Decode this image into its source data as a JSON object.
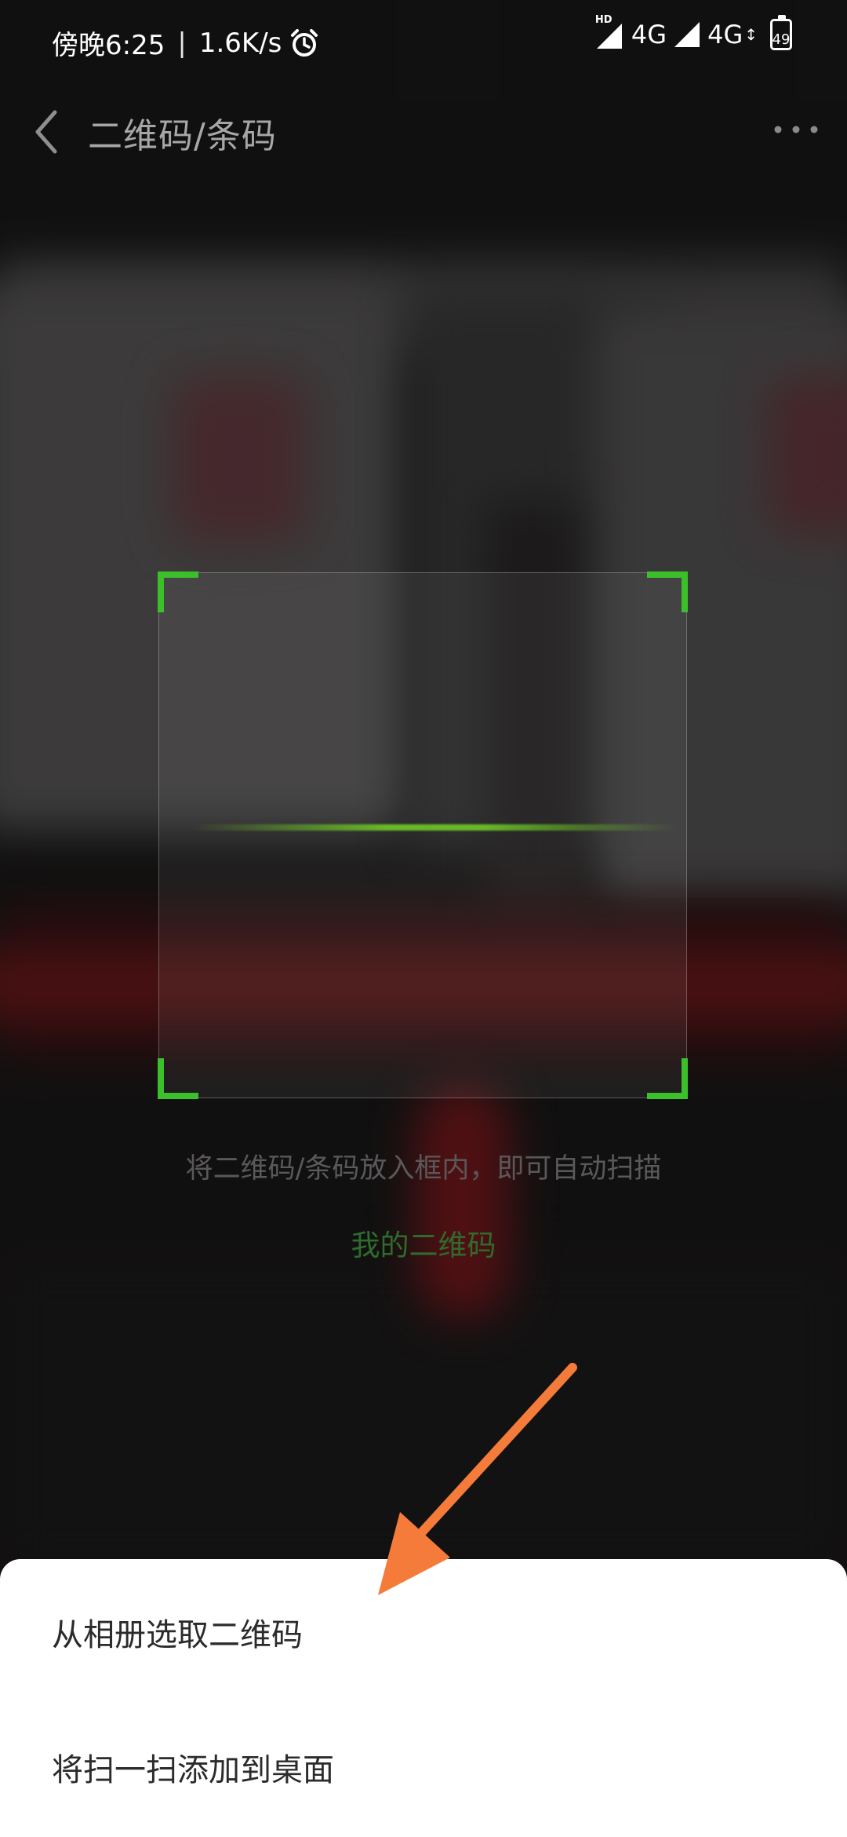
{
  "status_bar": {
    "time": "傍晚6:25",
    "separator": "|",
    "speed": "1.6K/s",
    "network1": "4G",
    "network2": "4G",
    "battery": "49",
    "hd_label": "HD"
  },
  "header": {
    "title": "二维码/条码"
  },
  "scan": {
    "hint": "将二维码/条码放入框内，即可自动扫描",
    "my_qr_link": "我的二维码"
  },
  "sheet": {
    "items": [
      {
        "label": "从相册选取二维码"
      },
      {
        "label": "将扫一扫添加到桌面"
      }
    ]
  },
  "colors": {
    "accent_green": "#3bbf2a",
    "annotation_orange": "#f47b3a"
  }
}
